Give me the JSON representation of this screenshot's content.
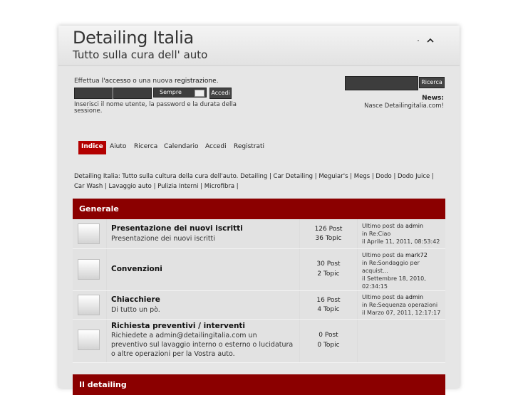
{
  "header": {
    "title": "Detailing Italia",
    "subtitle": "Tutto sulla cura dell' auto"
  },
  "login": {
    "hint_prefix": "Effettua ",
    "hint_access": "l'accesso",
    "hint_middle": " o una nuova ",
    "hint_register": "registrazione",
    "hint_suffix": ".",
    "duration_value": "Sempre",
    "submit_label": "Accedi",
    "help": "Inserisci il nome utente, la password e la durata della sessione."
  },
  "search": {
    "button_label": "Ricerca"
  },
  "news": {
    "label": "News:",
    "text": "Nasce Detailingitalia.com!"
  },
  "nav": {
    "items": [
      "Indice",
      "Aiuto",
      "Ricerca",
      "Calendario",
      "Accedi",
      "Registrati"
    ]
  },
  "description": "Detailing Italia: Tutto sulla cultura della cura dell'auto. Detailing | Car Detailing | Meguiar's | Megs | Dodo | Dodo Juice | Car Wash | Lavaggio auto | Pulizia Interni | Microfibra |",
  "categories": [
    {
      "name": "Generale"
    },
    {
      "name": "Il detailing"
    }
  ],
  "boards": [
    {
      "title": "Presentazione dei nuovi iscritti",
      "description": "Presentazione dei nuovi iscritti",
      "posts": "126 Post",
      "topics": "36 Topic",
      "last_label": "Ultimo post",
      "last_by": "da",
      "last_user": "admin",
      "last_in": "in",
      "last_topic": "Re:Ciao",
      "last_date": "il Aprile 11, 2011, 08:53:42"
    },
    {
      "title": "Convenzioni",
      "description": "",
      "posts": "30 Post",
      "topics": "2 Topic",
      "last_label": "Ultimo post",
      "last_by": "da",
      "last_user": "mark72",
      "last_in": "in",
      "last_topic": "Re:Sondaggio per acquist...",
      "last_date": "il Settembre 18, 2010, 02:34:15"
    },
    {
      "title": "Chiacchiere",
      "description": "Di tutto un pò.",
      "posts": "16 Post",
      "topics": "4 Topic",
      "last_label": "Ultimo post",
      "last_by": "da",
      "last_user": "admin",
      "last_in": "in",
      "last_topic": "Re:Sequenza operazioni",
      "last_date": "il Marzo 07, 2011, 12:17:17"
    },
    {
      "title": "Richiesta preventivi / interventi",
      "description": "Richiedete a admin@detailingitalia.com un preventivo sul lavaggio interno o esterno o lucidatura o altre operazioni per la Vostra auto.",
      "posts": "0 Post",
      "topics": "0 Topic"
    }
  ],
  "colors": {
    "accent": "#8b0000",
    "nav_active": "#b30000"
  }
}
